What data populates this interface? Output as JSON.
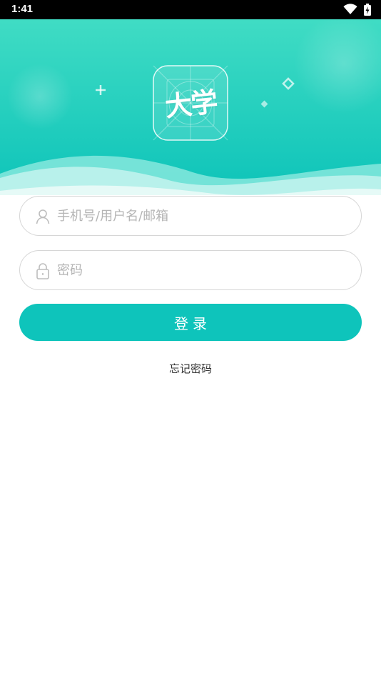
{
  "status_bar": {
    "time": "1:41",
    "icons": [
      "wifi-icon",
      "battery-charging-icon"
    ]
  },
  "header": {
    "logo_text": "大学",
    "gradient_colors": [
      "#40dcc4",
      "#0cc3b9"
    ]
  },
  "form": {
    "username_placeholder": "手机号/用户名/邮箱",
    "username_value": "",
    "password_placeholder": "密码",
    "password_value": "",
    "login_label": "登录",
    "forgot_password_label": "忘记密码"
  },
  "colors": {
    "accent": "#0ec4bb",
    "field_border": "#d6d6d6",
    "placeholder": "#b5b5b5"
  }
}
